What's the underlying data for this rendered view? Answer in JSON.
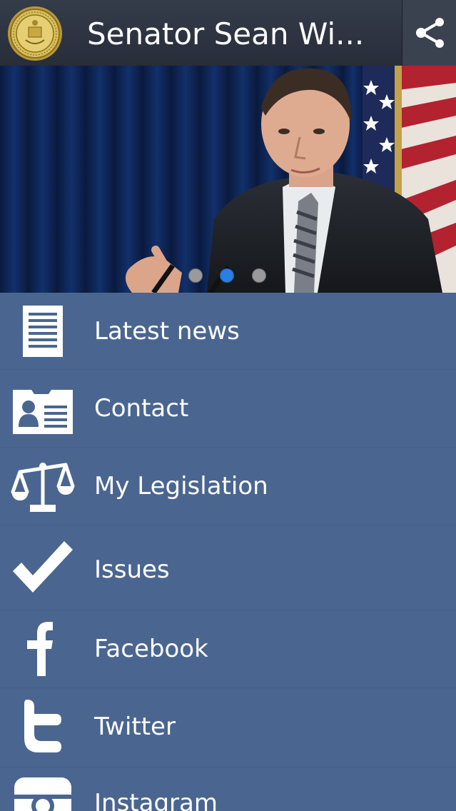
{
  "header": {
    "title": "Senator Sean Wi...",
    "seal_icon": "state-seal-icon",
    "share_icon": "share-icon"
  },
  "hero": {
    "slide_count": 3,
    "active_slide": 2
  },
  "menu": {
    "items": [
      {
        "label": "Latest news",
        "icon": "document-icon"
      },
      {
        "label": "Contact",
        "icon": "contact-card-icon"
      },
      {
        "label": "My Legislation",
        "icon": "scales-icon"
      },
      {
        "label": "Issues",
        "icon": "checkmark-icon"
      },
      {
        "label": "Facebook",
        "icon": "facebook-icon"
      },
      {
        "label": "Twitter",
        "icon": "twitter-icon"
      },
      {
        "label": "Instagram",
        "icon": "instagram-icon"
      }
    ]
  },
  "colors": {
    "header_bg": "#2f3542",
    "menu_bg": "#4a6690",
    "divider": "#42608a",
    "active_dot": "#2a7fe0",
    "inactive_dot": "#9a9a9a"
  }
}
